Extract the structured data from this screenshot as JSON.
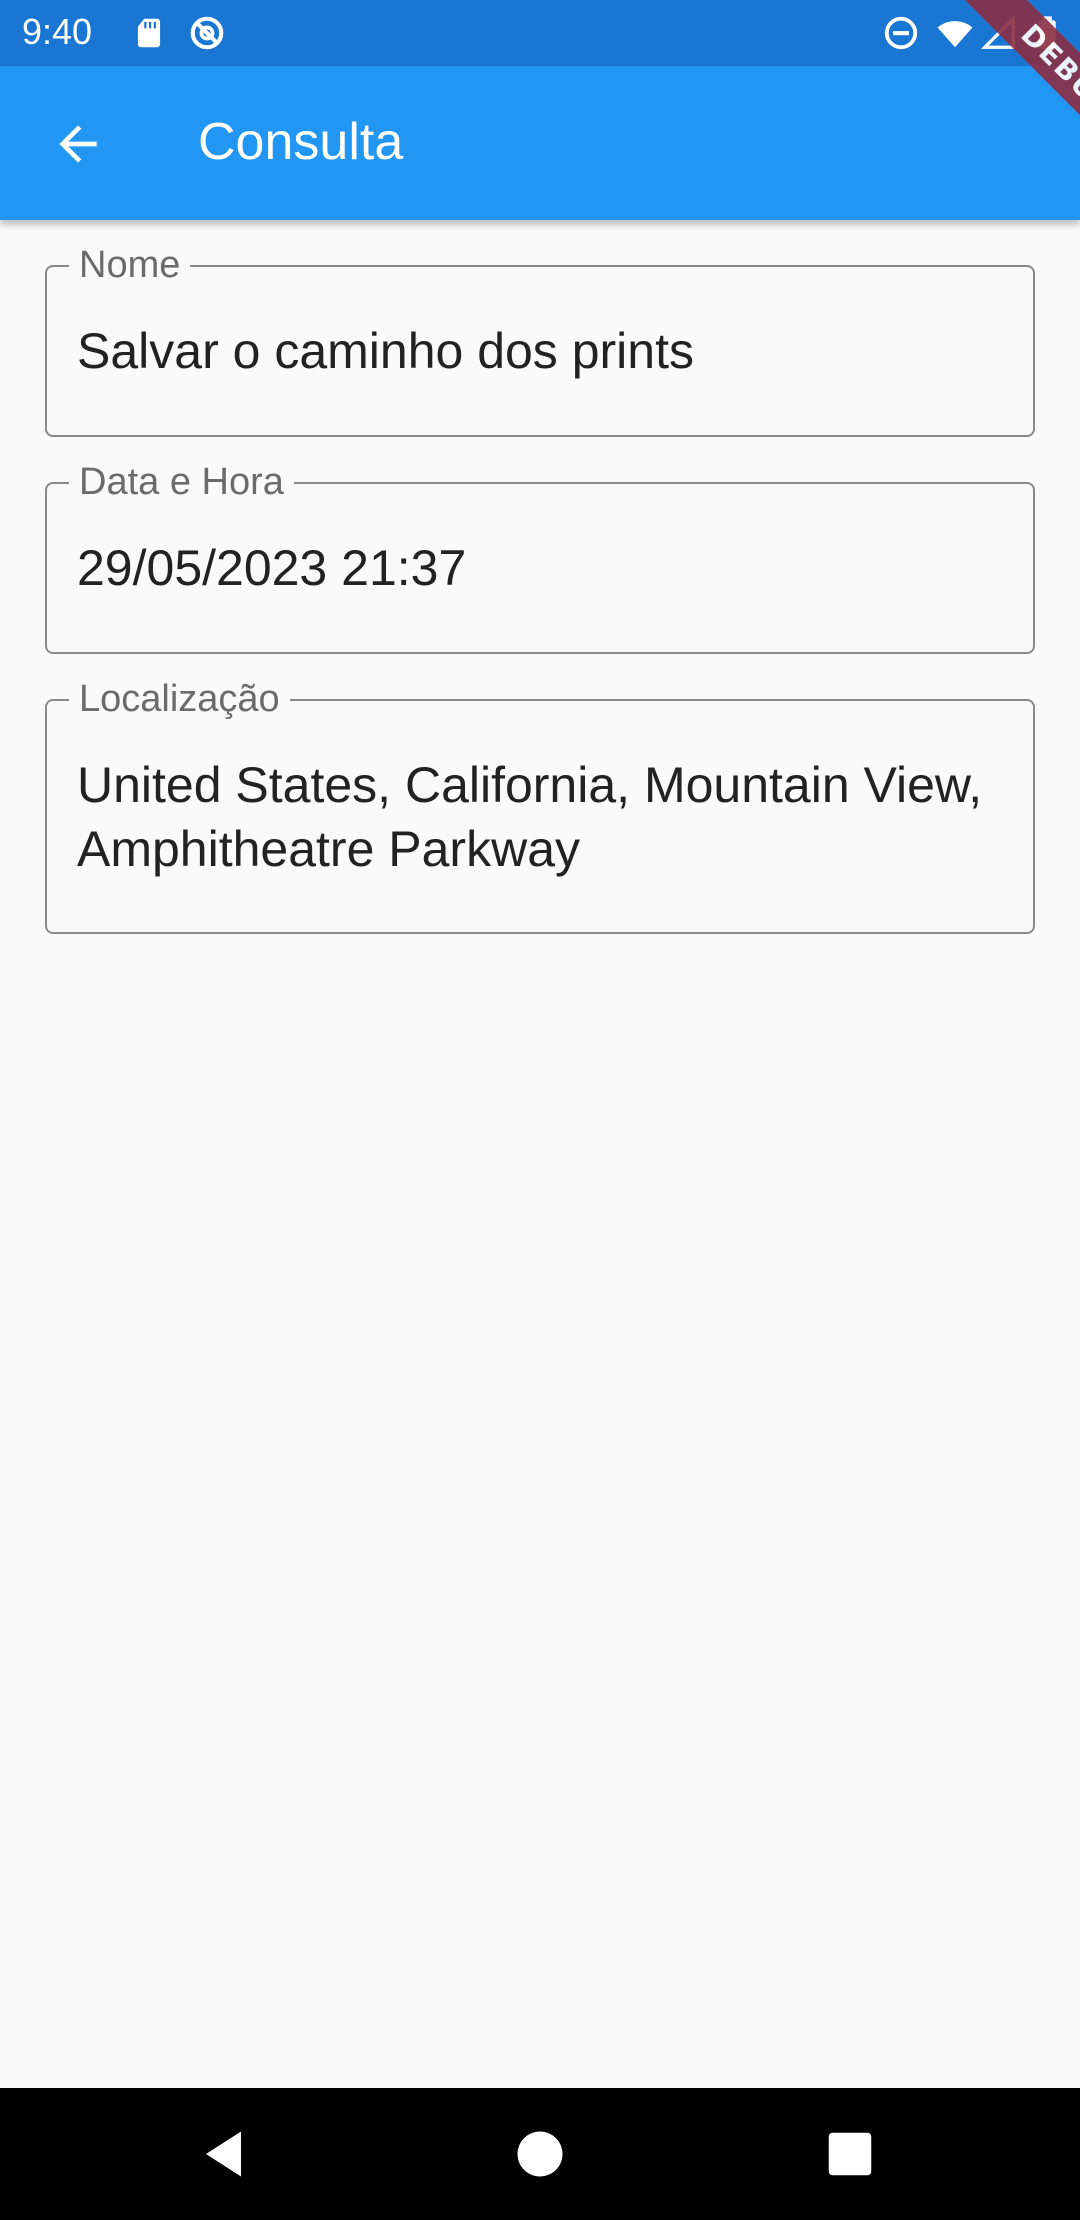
{
  "status_bar": {
    "time": "9:40",
    "left_icons": [
      "sd-card-icon",
      "no-sync-icon"
    ],
    "right_icons": [
      "do-not-disturb-icon",
      "wifi-icon",
      "signal-icon",
      "battery-icon"
    ]
  },
  "app_bar": {
    "title": "Consulta",
    "back_icon": "arrow-back-icon",
    "color": "#2196f3"
  },
  "debug_banner": "DEBUG",
  "fields": [
    {
      "label": "Nome",
      "value": "Salvar o caminho dos prints"
    },
    {
      "label": "Data e Hora",
      "value": "29/05/2023 21:37"
    },
    {
      "label": "Localização",
      "value": "United States, California, Mountain View, Amphitheatre Parkway"
    }
  ],
  "nav_bar": {
    "buttons": [
      "back-triangle-icon",
      "home-circle-icon",
      "recents-square-icon"
    ]
  }
}
